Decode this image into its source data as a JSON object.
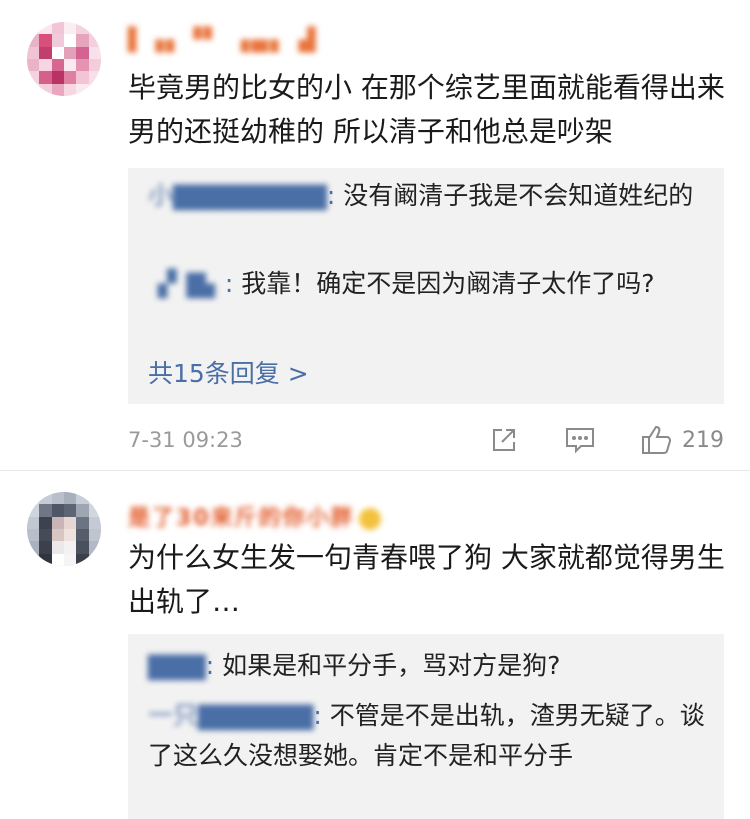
{
  "comments": [
    {
      "username": "▌▗▖▝▘ ▗▄▖ ▟",
      "text": "毕竟男的比女的小 在那个综艺里面就能看得出来 男的还挺幼稚的 所以清子和他总是吵架",
      "replies": [
        {
          "name": "小▇▇▇▇▇▇▇▇",
          "colon": ":",
          "text": "没有阚清子我是不会知道姓纪的"
        },
        {
          "name": "▗▘▇▖",
          "colon": ":",
          "text": "我靠！确定不是因为阚清子太作了吗?"
        }
      ],
      "more_replies": "共15条回复 >",
      "time": "7-31 09:23",
      "like_count": "219",
      "icons": {
        "share": "share-icon",
        "comment": "comment-icon",
        "like": "like-icon"
      }
    },
    {
      "username": "是了30来斤的你小胖",
      "text": "为什么女生发一句青春喂了狗 大家就都觉得男生出轨了…",
      "replies": [
        {
          "name": "▇▇▇",
          "colon": ":",
          "text": "如果是和平分手，骂对方是狗?"
        },
        {
          "name": "一只▇▇▇▇▇▇",
          "colon": ":",
          "text": "不管是不是出轨，渣男无疑了。谈了这么久没想娶她。肯定不是和平分手"
        }
      ]
    }
  ],
  "colors": {
    "link": "#4a6ea6",
    "reply_bg": "#f2f2f2",
    "meta": "#9a9a9a"
  }
}
